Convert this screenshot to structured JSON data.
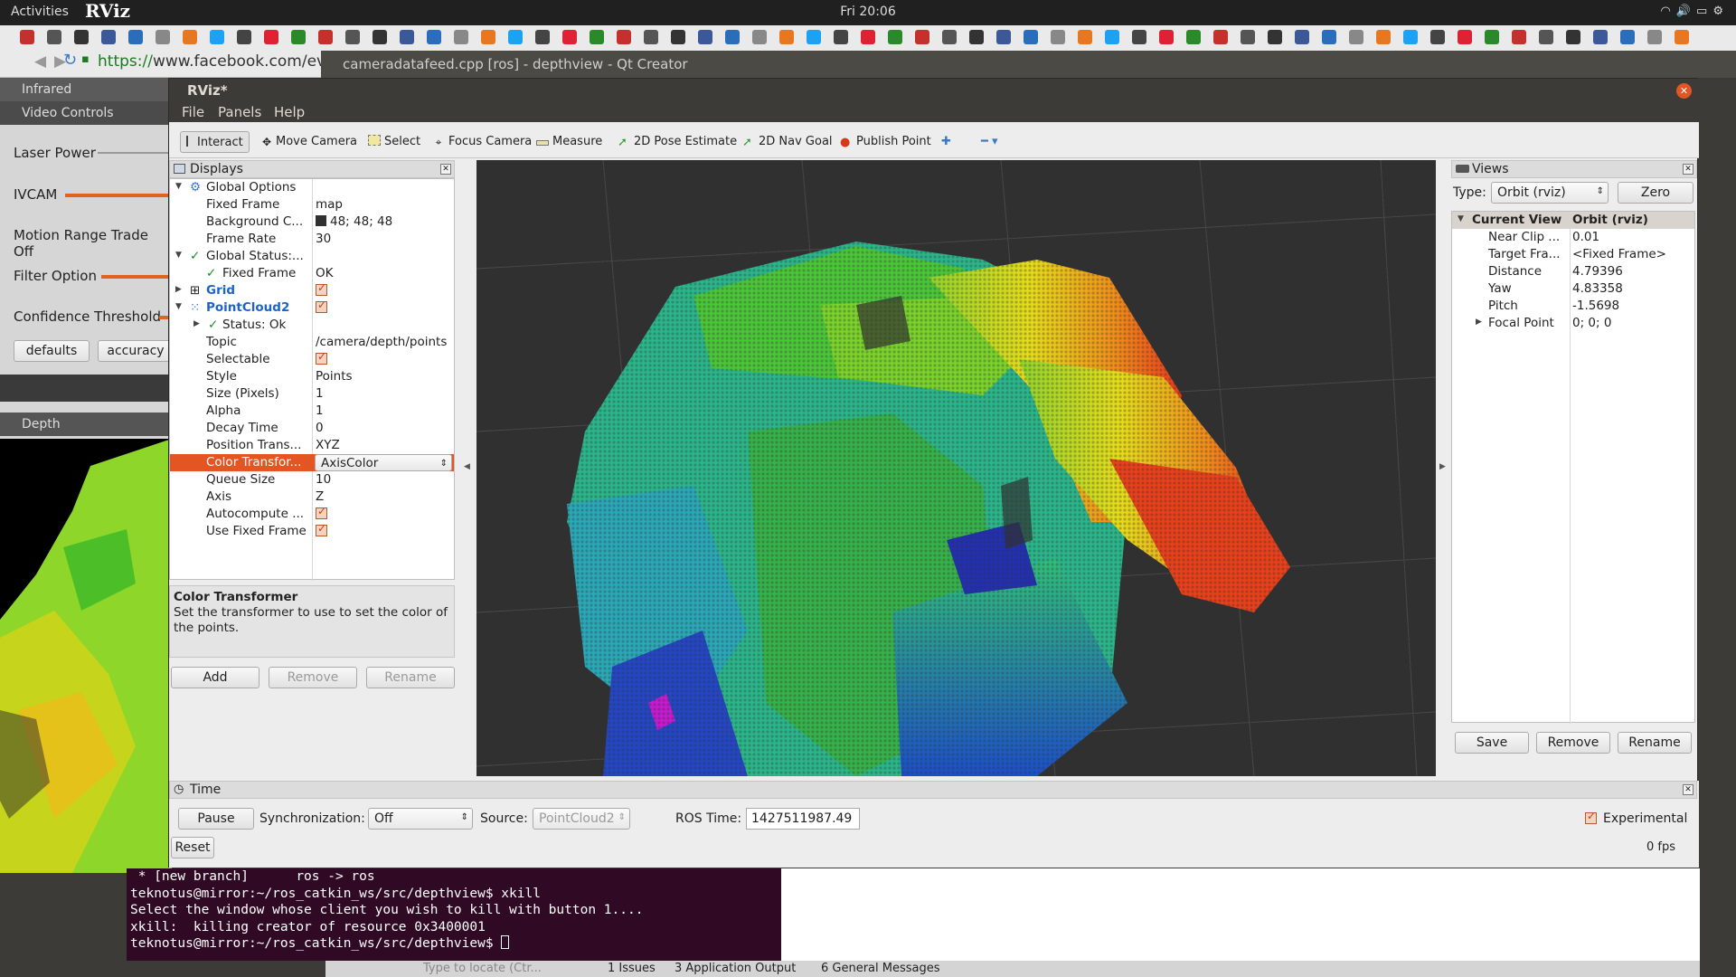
{
  "topbar": {
    "activities": "Activities",
    "clock": "Fri 20:06",
    "app_logo": "RViz"
  },
  "browser": {
    "url_scheme": "https://",
    "url_rest": "www.facebook.com/event"
  },
  "qtcreator": {
    "title": "cameradatafeed.cpp [ros] - depthview - Qt Creator"
  },
  "leftpanel": {
    "infrared": "Infrared",
    "video_controls": "Video Controls",
    "laser_power": "Laser Power",
    "ivcam": "IVCAM",
    "motion_range": "Motion Range Trade Off",
    "filter_option": "Filter Option",
    "confidence": "Confidence Threshold",
    "defaults": "defaults",
    "accuracy": "accuracy",
    "depth": "Depth"
  },
  "rviz": {
    "title": "RViz*",
    "menu": {
      "file": "File",
      "panels": "Panels",
      "help": "Help"
    },
    "tools": {
      "interact": "Interact",
      "move_camera": "Move Camera",
      "select": "Select",
      "focus_camera": "Focus Camera",
      "measure": "Measure",
      "pose_estimate": "2D Pose Estimate",
      "nav_goal": "2D Nav Goal",
      "publish_point": "Publish Point"
    },
    "displays": {
      "title": "Displays",
      "rows": [
        {
          "k": "Global Options",
          "v": ""
        },
        {
          "k": "Fixed Frame",
          "v": "map"
        },
        {
          "k": "Background C...",
          "v": "48; 48; 48"
        },
        {
          "k": "Frame Rate",
          "v": "30"
        },
        {
          "k": "Global Status:...",
          "v": ""
        },
        {
          "k": "Fixed Frame",
          "v": "OK"
        },
        {
          "k": "Grid",
          "v": ""
        },
        {
          "k": "PointCloud2",
          "v": ""
        },
        {
          "k": "Status: Ok",
          "v": ""
        },
        {
          "k": "Topic",
          "v": "/camera/depth/points"
        },
        {
          "k": "Selectable",
          "v": ""
        },
        {
          "k": "Style",
          "v": "Points"
        },
        {
          "k": "Size (Pixels)",
          "v": "1"
        },
        {
          "k": "Alpha",
          "v": "1"
        },
        {
          "k": "Decay Time",
          "v": "0"
        },
        {
          "k": "Position Trans...",
          "v": "XYZ"
        },
        {
          "k": "Color Transfor...",
          "v": "AxisColor"
        },
        {
          "k": "Queue Size",
          "v": "10"
        },
        {
          "k": "Axis",
          "v": "Z"
        },
        {
          "k": "Autocompute ...",
          "v": ""
        },
        {
          "k": "Use Fixed Frame",
          "v": ""
        }
      ],
      "desc_title": "Color Transformer",
      "desc_text": "Set the transformer to use to set the color of the points.",
      "add": "Add",
      "remove": "Remove",
      "rename": "Rename"
    },
    "views": {
      "title": "Views",
      "type_label": "Type:",
      "type_value": "Orbit (rviz)",
      "zero": "Zero",
      "header_k": "Current View",
      "header_v": "Orbit (rviz)",
      "rows": [
        {
          "k": "Near Clip ...",
          "v": "0.01"
        },
        {
          "k": "Target Fra...",
          "v": "<Fixed Frame>"
        },
        {
          "k": "Distance",
          "v": "4.79396"
        },
        {
          "k": "Yaw",
          "v": "4.83358"
        },
        {
          "k": "Pitch",
          "v": "-1.5698"
        },
        {
          "k": "Focal Point",
          "v": "0; 0; 0"
        }
      ],
      "save": "Save",
      "remove": "Remove",
      "rename": "Rename"
    },
    "time": {
      "title": "Time",
      "pause": "Pause",
      "sync_label": "Synchronization:",
      "sync_value": "Off",
      "source_label": "Source:",
      "source_value": "PointCloud2",
      "ros_time_label": "ROS Time:",
      "ros_time_value": "1427511987.49",
      "experimental": "Experimental",
      "reset": "Reset",
      "fps": "0 fps"
    }
  },
  "terminal": {
    "lines": [
      " * [new branch]      ros -> ros",
      "teknotus@mirror:~/ros_catkin_ws/src/depthview$ xkill",
      "Select the window whose client you wish to kill with button 1....",
      "xkill:  killing creator of resource 0x3400001",
      "teknotus@mirror:~/ros_catkin_ws/src/depthview$ "
    ]
  },
  "statusbar": {
    "locate_placeholder": "Type to locate (Ctr...",
    "issues": "1 Issues",
    "app_output": "3 Application Output",
    "general": "6 General Messages"
  },
  "colors": {
    "accent": "#e45524",
    "view_bg": "#303030",
    "terminal_bg": "#300a24"
  }
}
